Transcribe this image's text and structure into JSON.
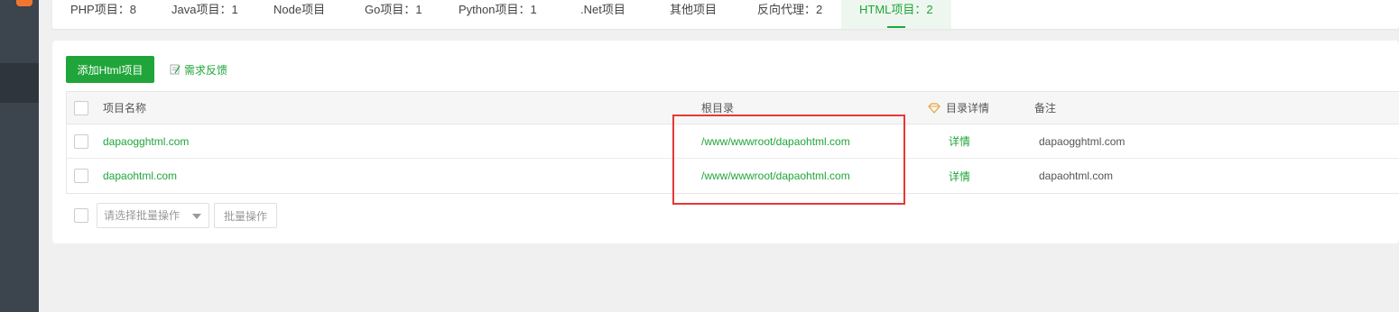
{
  "tabs": [
    {
      "label": "PHP项目：8"
    },
    {
      "label": "Java项目：1"
    },
    {
      "label": "Node项目"
    },
    {
      "label": "Go项目：1"
    },
    {
      "label": "Python项目：1"
    },
    {
      "label": ".Net项目"
    },
    {
      "label": "其他项目"
    },
    {
      "label": "反向代理：2"
    },
    {
      "label": "HTML项目：2"
    }
  ],
  "active_tab": "HTML项目：2",
  "toolbar": {
    "add_label": "添加Html项目",
    "feedback_label": "需求反馈"
  },
  "table": {
    "headers": {
      "name": "项目名称",
      "root": "根目录",
      "detail": "目录详情",
      "remark": "备注"
    },
    "rows": [
      {
        "name": "dapaogghtml.com",
        "root": "/www/wwwroot/dapaohtml.com",
        "detail": "详情",
        "remark": "dapaogghtml.com"
      },
      {
        "name": "dapaohtml.com",
        "root": "/www/wwwroot/dapaohtml.com",
        "detail": "详情",
        "remark": "dapaohtml.com"
      }
    ]
  },
  "batch": {
    "select_placeholder": "请选择批量操作",
    "button_label": "批量操作"
  },
  "colors": {
    "accent": "#20a53a",
    "sidebar": "#3c444d",
    "highlight": "#e53935"
  }
}
